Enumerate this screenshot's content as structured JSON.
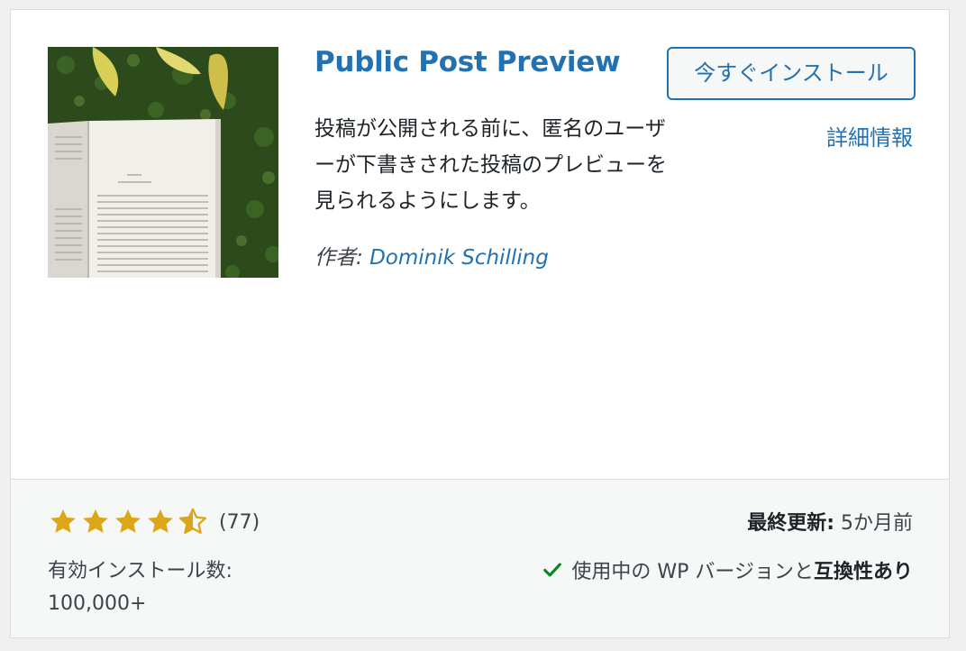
{
  "plugin": {
    "name": "Public Post Preview",
    "install_button": "今すぐインストール",
    "details_link": "詳細情報",
    "description": "投稿が公開される前に、匿名のユーザーが下書きされた投稿のプレビューを見られるようにします。",
    "author_label": "作者:",
    "author_name": "Dominik Schilling",
    "thumbnail_icon": "open-book-on-grass-image"
  },
  "footer": {
    "rating": 4.5,
    "rating_max": 5,
    "rating_count": "(77)",
    "installs_label": "有効インストール数:",
    "installs_value": "100,000+",
    "last_updated_label": "最終更新:",
    "last_updated_value": "5か月前",
    "compat_text": "使用中の WP バージョンと",
    "compat_strong": "互換性あり"
  },
  "colors": {
    "accent": "#2271b1",
    "star": "#dba617",
    "check": "#008a20"
  }
}
